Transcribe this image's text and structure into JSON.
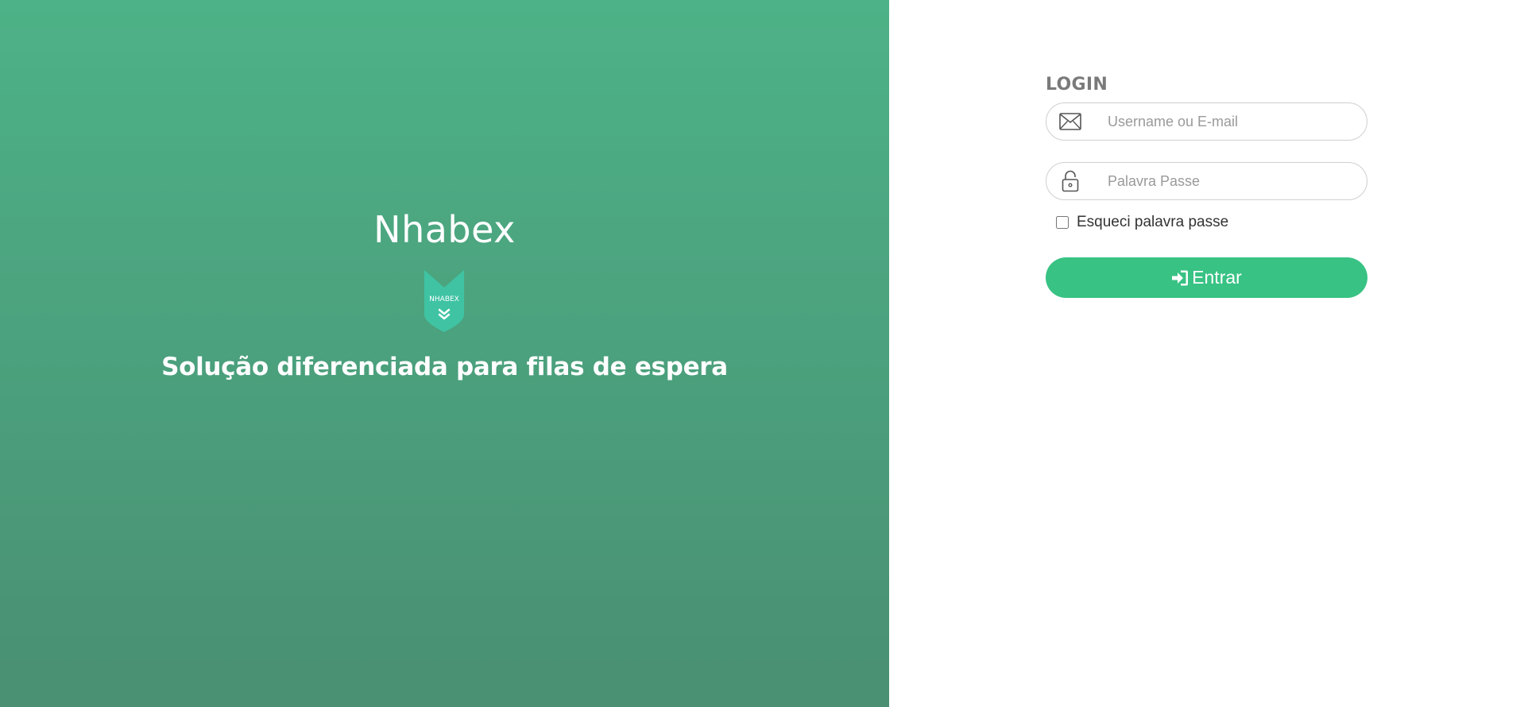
{
  "brand": {
    "name": "Nhabex",
    "logo_text": "NHABEX",
    "tagline": "Solução diferenciada para filas de espera",
    "colors": {
      "panel_top": "#4db287",
      "panel_bottom": "#4a8f72",
      "logo_fill": "#3fc3a3"
    }
  },
  "login": {
    "title": "LOGIN",
    "username": {
      "placeholder": "Username ou E-mail",
      "value": "",
      "icon": "envelope-icon"
    },
    "password": {
      "placeholder": "Palavra Passe",
      "value": "",
      "icon": "lock-icon"
    },
    "forgot": {
      "label": "Esqueci palavra passe",
      "checked": false
    },
    "submit": {
      "label": "Entrar",
      "icon": "sign-in-icon",
      "color": "#38c284"
    }
  }
}
